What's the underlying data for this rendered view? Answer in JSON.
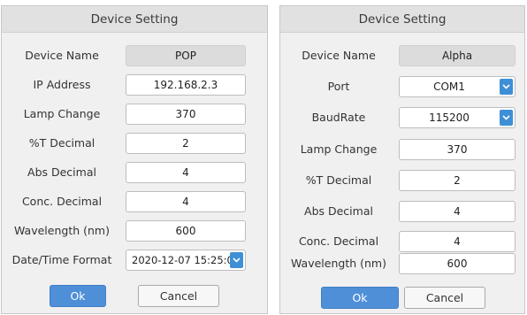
{
  "left_dialog": {
    "title": "Device Setting",
    "fields": [
      {
        "label": "Device Name",
        "value": "POP"
      },
      {
        "label": "IP Address",
        "value": "192.168.2.3"
      },
      {
        "label": "Lamp Change",
        "value": "370"
      },
      {
        "label": "%T Decimal",
        "value": "2"
      },
      {
        "label": "Abs Decimal",
        "value": "4"
      },
      {
        "label": "Conc. Decimal",
        "value": "4"
      },
      {
        "label": "Wavelength (nm)",
        "value": "600"
      },
      {
        "label": "Date/Time Format",
        "value": "2020-12-07 15:25:0"
      }
    ],
    "ok_label": "Ok",
    "cancel_label": "Cancel"
  },
  "right_dialog": {
    "title": "Device Setting",
    "fields": [
      {
        "label": "Device Name",
        "value": "Alpha"
      },
      {
        "label": "Port",
        "value": "COM1"
      },
      {
        "label": "BaudRate",
        "value": "115200"
      },
      {
        "label": "Lamp Change",
        "value": "370"
      },
      {
        "label": "%T Decimal",
        "value": "2"
      },
      {
        "label": "Abs Decimal",
        "value": "4"
      },
      {
        "label": "Conc. Decimal",
        "value": "4"
      },
      {
        "label": "Wavelength (nm)",
        "value": "600"
      }
    ],
    "ok_label": "Ok",
    "cancel_label": "Cancel"
  },
  "icons": {
    "dropdown": "chevron-down-icon"
  },
  "colors": {
    "accent": "#4f8fd8",
    "dialog_bg": "#f0f0f0",
    "titlebar_bg": "#e1e1e1"
  }
}
